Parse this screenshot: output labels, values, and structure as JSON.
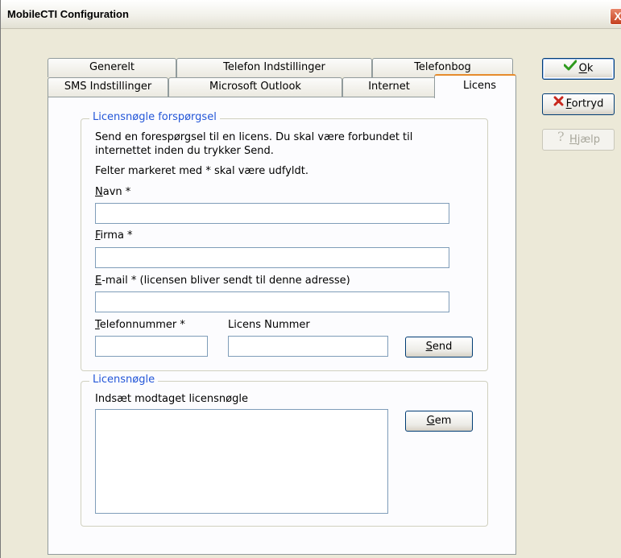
{
  "window": {
    "title": "MobileCTI Configuration",
    "close_glyph": "X"
  },
  "tabs": {
    "row_back": [
      "Generelt",
      "Telefon Indstillinger",
      "Telefonbog"
    ],
    "row_front": [
      "SMS Indstillinger",
      "Microsoft Outlook",
      "Internet",
      "Licens"
    ],
    "active": "Licens"
  },
  "request": {
    "legend": "Licensnøgle forspørgsel",
    "intro_line1": "Send en forespørgsel til en licens. Du skal være forbundet til",
    "intro_line2": "internettet inden du trykker Send.",
    "required_note": "Felter markeret med * skal være udfyldt.",
    "name": {
      "hotkey": "N",
      "label": "avn *",
      "value": ""
    },
    "company": {
      "hotkey": "F",
      "label": "irma *",
      "value": ""
    },
    "email": {
      "hotkey": "E",
      "label": "-mail * (licensen bliver sendt til denne adresse)",
      "value": ""
    },
    "phone": {
      "hotkey": "T",
      "label": "elefonnummer *",
      "value": ""
    },
    "license_number": {
      "label": "Licens Nummer",
      "value": ""
    },
    "send_button": {
      "hotkey": "S",
      "label": "end"
    }
  },
  "license_key": {
    "legend": "Licensnøgle",
    "paste_label": "Indsæt modtaget licensnøgle",
    "value": "",
    "save_button": {
      "hotkey": "G",
      "label": "em"
    }
  },
  "side_buttons": {
    "ok": {
      "hotkey": "O",
      "label": "k"
    },
    "cancel": {
      "hotkey": "F",
      "label": "ortryd"
    },
    "help": {
      "hotkey": "H",
      "label": "jælp"
    }
  },
  "colors": {
    "legend": "#2356d8",
    "active_tab_accent": "#e68b2c",
    "ok_check": "#2e9a1e",
    "cancel_x": "#c8281e"
  }
}
